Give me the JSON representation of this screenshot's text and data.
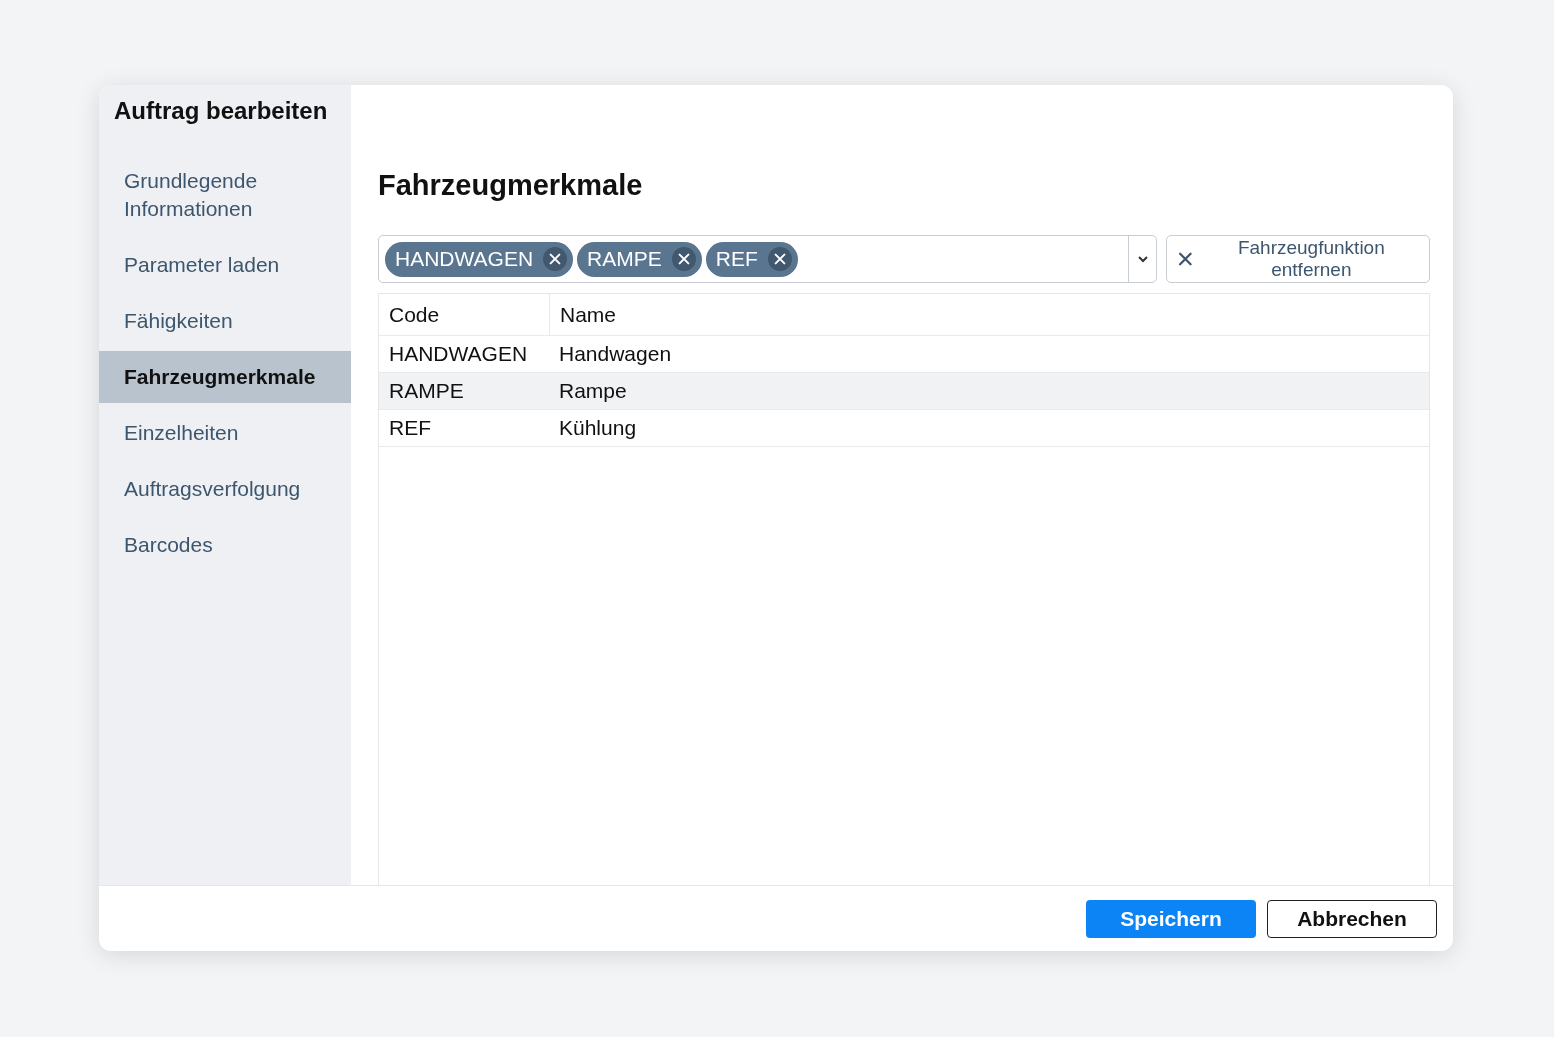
{
  "dialog": {
    "title": "Auftrag bearbeiten"
  },
  "sidebar": {
    "items": [
      {
        "label": "Grundlegende Informationen",
        "selected": false
      },
      {
        "label": "Parameter laden",
        "selected": false
      },
      {
        "label": "Fähigkeiten",
        "selected": false
      },
      {
        "label": "Fahrzeugmerkmale",
        "selected": true
      },
      {
        "label": "Einzelheiten",
        "selected": false
      },
      {
        "label": "Auftragsverfolgung",
        "selected": false
      },
      {
        "label": "Barcodes",
        "selected": false
      }
    ]
  },
  "section": {
    "title": "Fahrzeugmerkmale"
  },
  "tag_select": {
    "tags": [
      "HANDWAGEN",
      "RAMPE",
      "REF"
    ]
  },
  "remove_button": {
    "label": "Fahrzeugfunktion entfernen"
  },
  "table": {
    "columns": [
      "Code",
      "Name"
    ],
    "rows": [
      {
        "cells": [
          "HANDWAGEN",
          "Handwagen"
        ],
        "selected": false
      },
      {
        "cells": [
          "RAMPE",
          "Rampe"
        ],
        "selected": true
      },
      {
        "cells": [
          "REF",
          "Kühlung"
        ],
        "selected": false
      }
    ]
  },
  "footer": {
    "buttons": [
      {
        "label": "Speichern",
        "kind": "primary"
      },
      {
        "label": "Abbrechen",
        "kind": "secondary"
      }
    ]
  }
}
